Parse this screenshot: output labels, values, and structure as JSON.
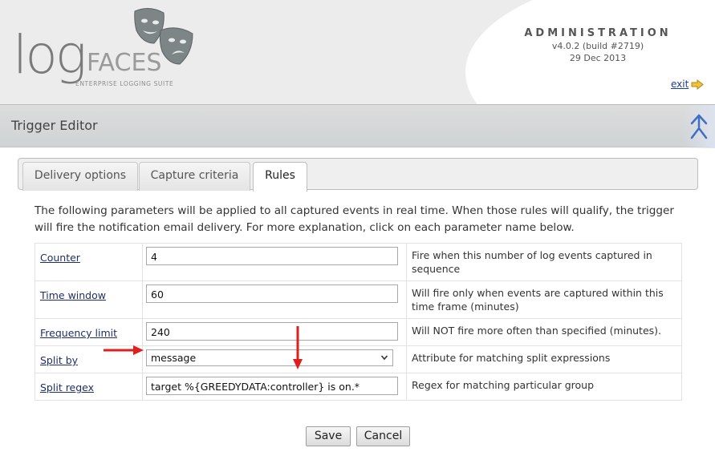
{
  "header": {
    "brand": {
      "log": "log",
      "faces": "FACES",
      "tagline": "ENTERPRISE LOGGING SUITE"
    },
    "admin_title": "ADMINISTRATION",
    "version": "v4.0.2 (build #2719)",
    "date": "29 Dec 2013",
    "exit_label": "exit"
  },
  "page": {
    "title": "Trigger Editor"
  },
  "tabs": [
    {
      "label": "Delivery options",
      "active": false
    },
    {
      "label": "Capture criteria",
      "active": false
    },
    {
      "label": "Rules",
      "active": true
    }
  ],
  "intro": "The following parameters will be applied to all captured events in real time. When those rules will qualify, the trigger will fire the notification email delivery. For more explanation, click on each parameter name below.",
  "rules": [
    {
      "name": "Counter",
      "value": "4",
      "description": "Fire when this number of log events captured in sequence"
    },
    {
      "name": "Time window",
      "value": "60",
      "description": "Will fire only when events are captured within this time frame (minutes)"
    },
    {
      "name": "Frequency limit",
      "value": "240",
      "description": "Will NOT fire more often than specified (minutes)."
    },
    {
      "name": "Split by",
      "value": "message",
      "description": "Attribute for matching split expressions"
    },
    {
      "name": "Split regex",
      "value": "target %{GREEDYDATA:controller} is on.*",
      "description": "Regex for matching particular group"
    }
  ],
  "buttons": {
    "save": "Save",
    "cancel": "Cancel"
  },
  "colors": {
    "link": "#1f2f66",
    "annotation_arrow": "#e01e1e",
    "collapse_icon": "#3f6fc4"
  }
}
